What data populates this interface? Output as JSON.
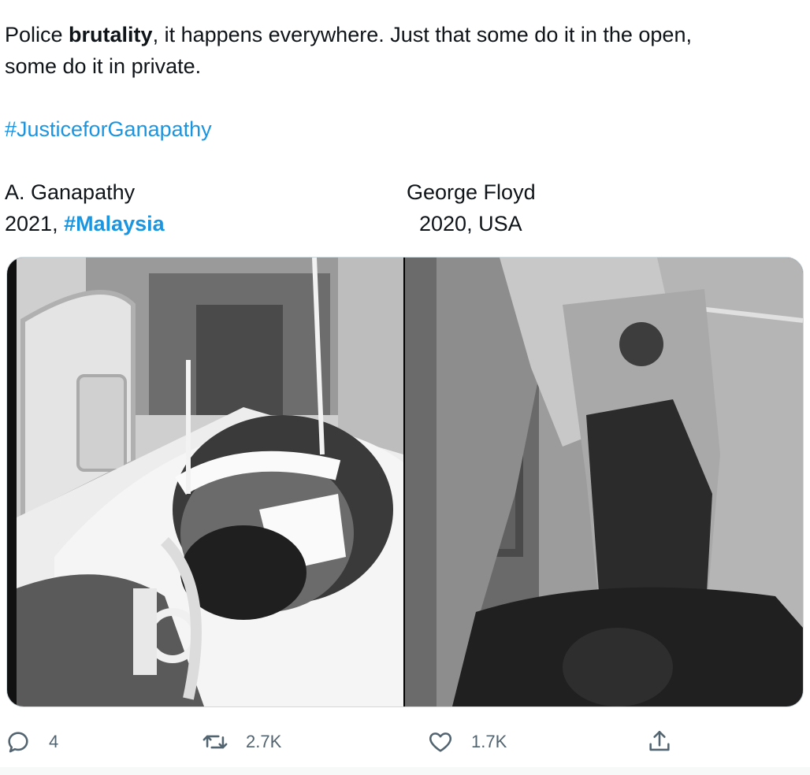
{
  "tweet": {
    "line1_pre": "Police ",
    "line1_bold": "brutality",
    "line1_post": ", it happens everywhere. Just that some do it in the open,",
    "line2": "some do it in private.",
    "hashtag": "#JusticeforGanapathy",
    "left_name": "A. Ganapathy",
    "left_year": "2021, ",
    "left_tag": "#Malaysia",
    "right_name": "George Floyd",
    "right_year": "2020, USA"
  },
  "media": {
    "left_photo": "hospital-bed-photo",
    "right_photo": "street-arrest-photo"
  },
  "actions": {
    "reply_count": "4",
    "retweet_count": "2.7K",
    "like_count": "1.7K"
  },
  "colors": {
    "hashtag": "#1b95e0",
    "icon": "#536471",
    "text": "#0f1419"
  }
}
